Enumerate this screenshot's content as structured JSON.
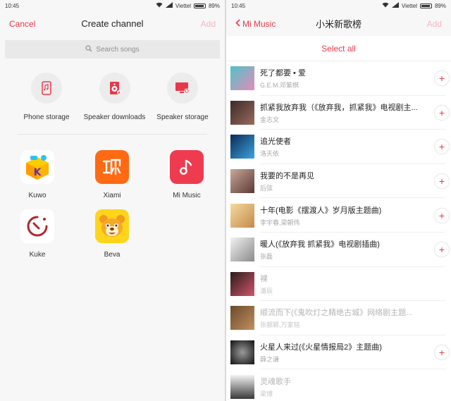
{
  "left": {
    "status": {
      "time": "10:45",
      "carrier": "Viettel",
      "battery": "89%"
    },
    "nav": {
      "cancel": "Cancel",
      "title": "Create channel",
      "add": "Add"
    },
    "search_placeholder": "Search songs",
    "storage": [
      {
        "label": "Phone storage",
        "icon": "phone-icon"
      },
      {
        "label": "Speaker downloads",
        "icon": "speaker-icon"
      },
      {
        "label": "Speaker storage",
        "icon": "monitor-icon"
      }
    ],
    "apps": [
      {
        "label": "Kuwo",
        "icon": "kuwo-icon"
      },
      {
        "label": "Xiami",
        "icon": "xiami-icon"
      },
      {
        "label": "Mi Music",
        "icon": "mi-music-icon"
      },
      {
        "label": "Kuke",
        "icon": "kuke-icon"
      },
      {
        "label": "Beva",
        "icon": "beva-icon"
      }
    ]
  },
  "right": {
    "status": {
      "time": "10:45",
      "carrier": "Viettel",
      "battery": "89%"
    },
    "nav": {
      "back": "Mi Music",
      "title": "小米新歌榜",
      "add": "Add"
    },
    "select_all": "Select all",
    "songs": [
      {
        "title": "死了都要 • 爱",
        "artist": "G.E.M.邓紫棋",
        "available": true
      },
      {
        "title": "抓紧我放弃我（《放弃我，抓紧我》电视剧主...",
        "artist": "金志文",
        "available": true
      },
      {
        "title": "追光使者",
        "artist": "洛天依",
        "available": true
      },
      {
        "title": "我要的不是再见",
        "artist": "后弦",
        "available": true
      },
      {
        "title": "十年(电影《摆渡人》岁月版主题曲)",
        "artist": "李宇春,梁朝伟",
        "available": true
      },
      {
        "title": "暖人(《放弃我 抓紧我》电视剧插曲)",
        "artist": "张磊",
        "available": true
      },
      {
        "title": "裸",
        "artist": "潘辰",
        "available": false
      },
      {
        "title": "顺流而下(《鬼吹灯之精绝古城》网络剧主题...",
        "artist": "张靓颖,万家铭",
        "available": false
      },
      {
        "title": "火星人来过(《火星情报局2》主题曲)",
        "artist": "薛之谦",
        "available": true
      },
      {
        "title": "灵魂歌手",
        "artist": "梁博",
        "available": false
      }
    ]
  },
  "colors": {
    "accent": "#e8394a",
    "accent_disabled": "#f2b8bf"
  }
}
